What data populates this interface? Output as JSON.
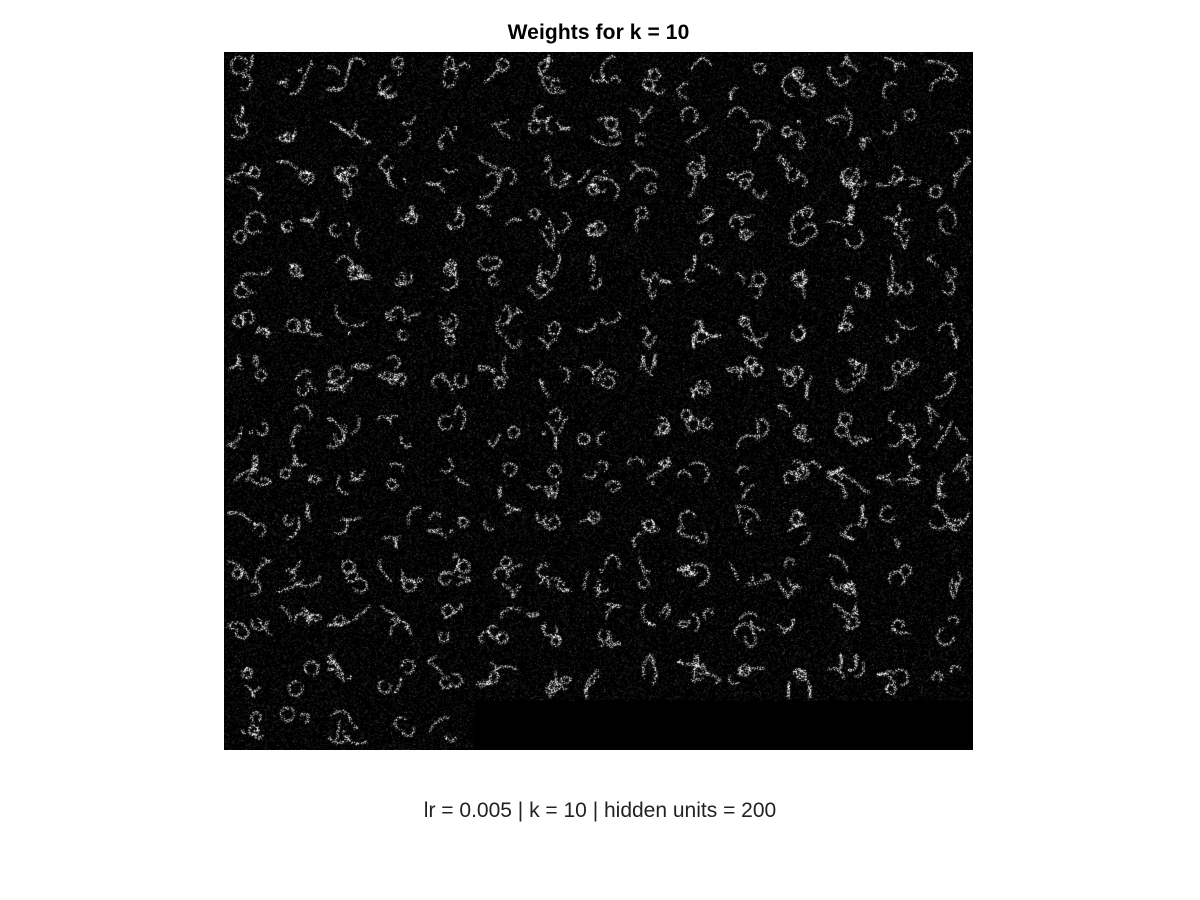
{
  "figure": {
    "title": "Weights for k = 10",
    "caption": "lr = 0.005 | k = 10 | hidden units = 200"
  },
  "weights_grid": {
    "hidden_units": 200,
    "columns": 15,
    "rows_shown": 14,
    "colormap": "grayscale",
    "background_color": "#000000"
  }
}
